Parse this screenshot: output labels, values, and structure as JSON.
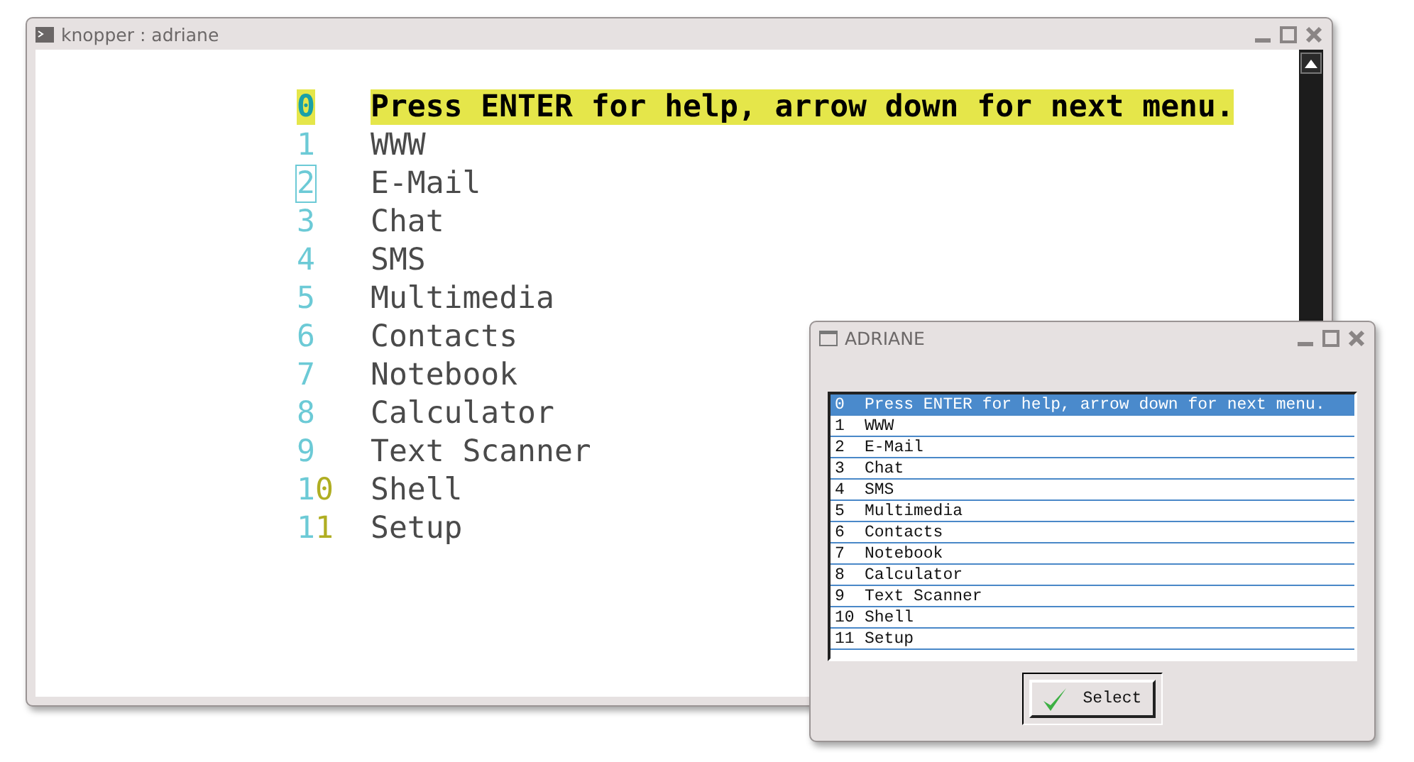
{
  "terminal": {
    "title": "knopper : adriane",
    "menu": [
      {
        "number": "0",
        "label": "Press ENTER for help, arrow down for next menu.",
        "selected": true,
        "cursor": false
      },
      {
        "number": "1",
        "label": "WWW",
        "selected": false,
        "cursor": false
      },
      {
        "number": "2",
        "label": "E-Mail",
        "selected": false,
        "cursor": true
      },
      {
        "number": "3",
        "label": "Chat",
        "selected": false,
        "cursor": false
      },
      {
        "number": "4",
        "label": "SMS",
        "selected": false,
        "cursor": false
      },
      {
        "number": "5",
        "label": "Multimedia",
        "selected": false,
        "cursor": false
      },
      {
        "number": "6",
        "label": "Contacts",
        "selected": false,
        "cursor": false
      },
      {
        "number": "7",
        "label": "Notebook",
        "selected": false,
        "cursor": false
      },
      {
        "number": "8",
        "label": "Calculator",
        "selected": false,
        "cursor": false
      },
      {
        "number": "9",
        "label": "Text Scanner",
        "selected": false,
        "cursor": false
      },
      {
        "number": "10",
        "label": "Shell",
        "selected": false,
        "cursor": false
      },
      {
        "number": "11",
        "label": "Setup",
        "selected": false,
        "cursor": false
      }
    ]
  },
  "dialog": {
    "title": "ADRIANE",
    "list": [
      {
        "number": "0",
        "label": "Press ENTER for help, arrow down for next menu.",
        "selected": true
      },
      {
        "number": "1",
        "label": "WWW",
        "selected": false
      },
      {
        "number": "2",
        "label": "E-Mail",
        "selected": false
      },
      {
        "number": "3",
        "label": "Chat",
        "selected": false
      },
      {
        "number": "4",
        "label": "SMS",
        "selected": false
      },
      {
        "number": "5",
        "label": "Multimedia",
        "selected": false
      },
      {
        "number": "6",
        "label": "Contacts",
        "selected": false
      },
      {
        "number": "7",
        "label": "Notebook",
        "selected": false
      },
      {
        "number": "8",
        "label": "Calculator",
        "selected": false
      },
      {
        "number": "9",
        "label": "Text Scanner",
        "selected": false
      },
      {
        "number": "10",
        "label": "Shell",
        "selected": false
      },
      {
        "number": "11",
        "label": "Setup",
        "selected": false
      }
    ],
    "button": "Select"
  }
}
